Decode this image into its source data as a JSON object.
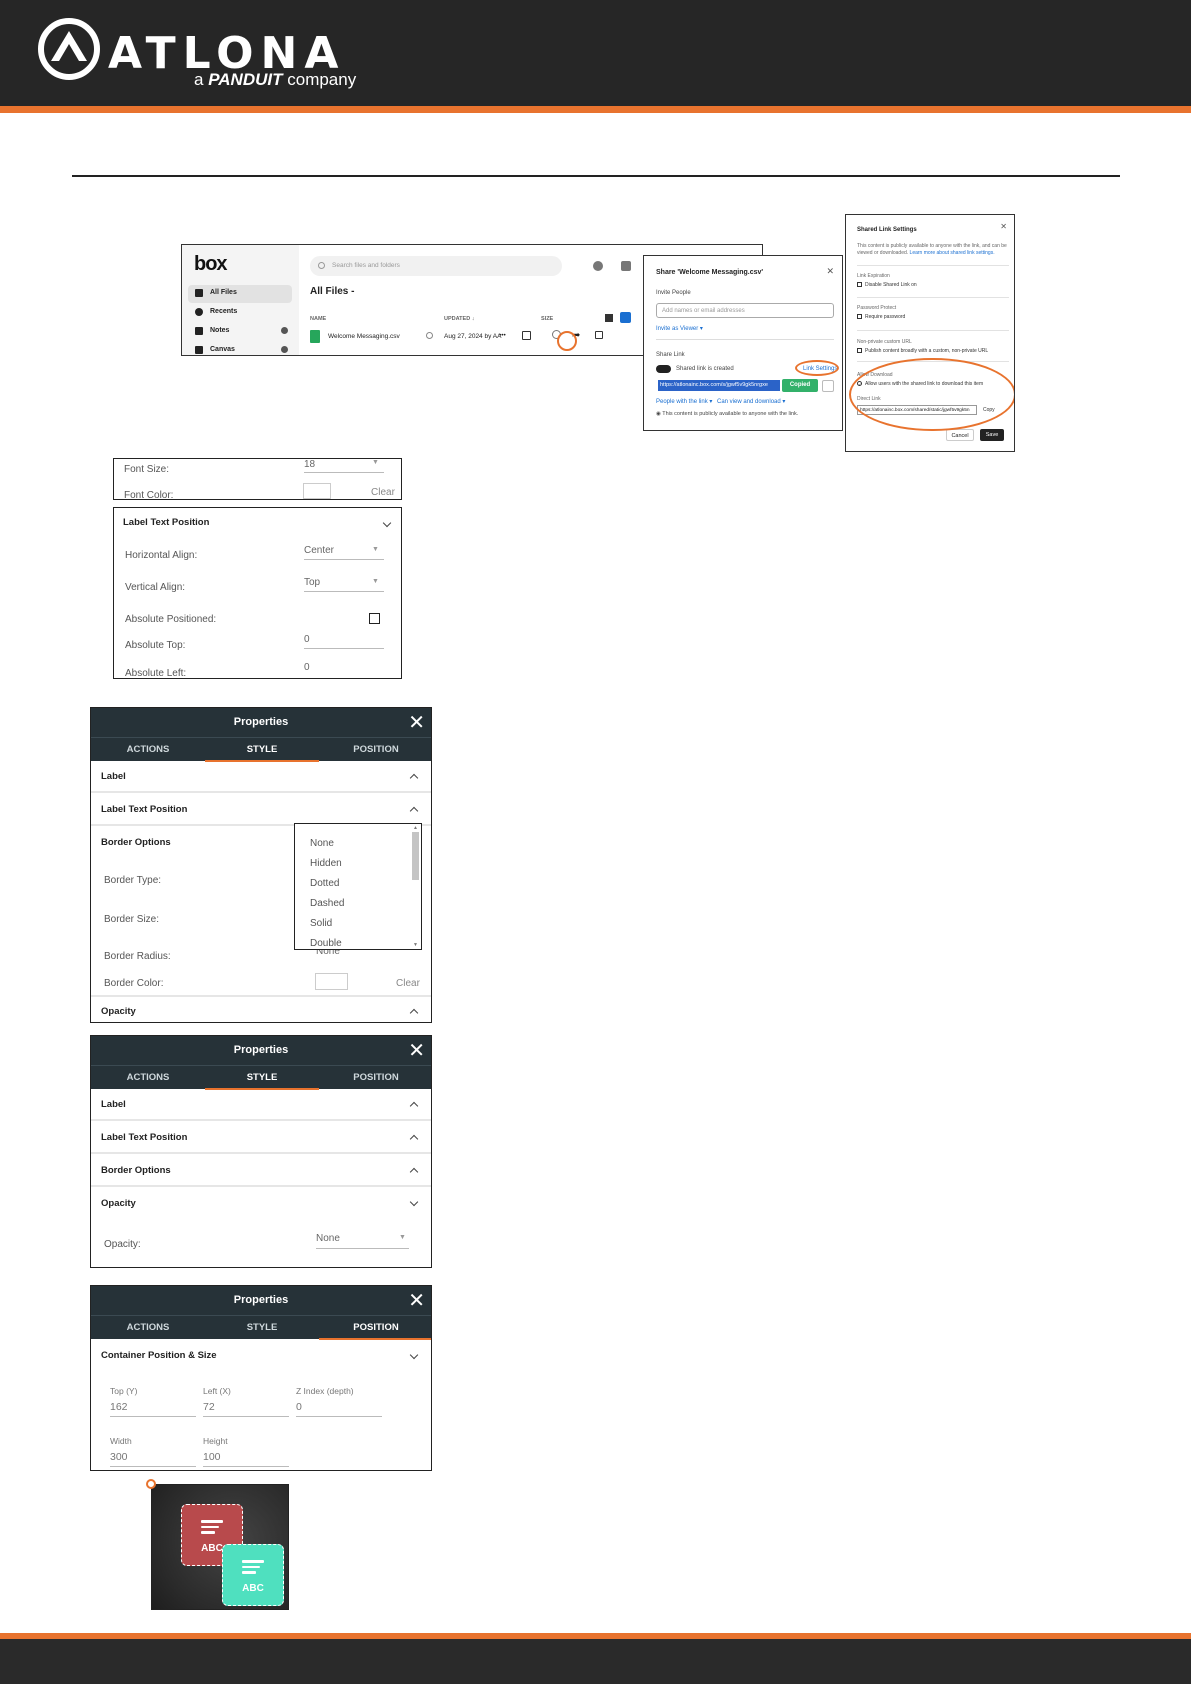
{
  "brand": {
    "name": "ATLONA",
    "tagline_prefix": "a",
    "tagline_brand": "PANDUIT",
    "tagline_suffix": "company",
    "accent_color": "#e8732e",
    "dark_color": "#262626"
  },
  "box_app": {
    "logo": "box",
    "nav": [
      {
        "label": "All Files",
        "icon": "folder-icon"
      },
      {
        "label": "Recents",
        "icon": "clock-icon"
      },
      {
        "label": "Notes",
        "icon": "notes-icon"
      },
      {
        "label": "Canvas",
        "icon": "canvas-icon"
      }
    ],
    "search_placeholder": "Search files and folders",
    "page_title": "All Files -",
    "columns": {
      "name": "NAME",
      "updated": "UPDATED ↓",
      "size": "SIZE"
    },
    "row": {
      "name": "Welcome Messaging.csv",
      "updated": "Aug 27, 2024 by AA",
      "more": "•••"
    }
  },
  "share_dialog": {
    "title": "Share 'Welcome Messaging.csv'",
    "invite_label": "Invite People",
    "invite_placeholder": "Add names or email addresses",
    "invite_role": "Invite as Viewer ▾",
    "share_link_label": "Share Link",
    "toggle_label": "Shared link is created",
    "link_settings": "Link Settings",
    "url": "https://atlonainc.box.com/s/jgwf5v9gk5nrgxe",
    "copied": "Copied",
    "people": "People with the link ▾",
    "permission": "Can view and download ▾",
    "notice": "This content is publicly available to anyone with the link."
  },
  "link_settings": {
    "title": "Shared Link Settings",
    "intro": "This content is publicly available to anyone with the link, and can be viewed or downloaded.",
    "intro_link": "Learn more about shared link settings.",
    "expiration_title": "Link Expiration",
    "expiration_option": "Disable Shared Link on",
    "password_title": "Password Protect",
    "password_option": "Require password",
    "vanity_title": "Non-private custom URL",
    "vanity_option": "Publish content broadly with a custom, non-private URL",
    "download_title": "Allow Download",
    "download_option": "Allow users with the shared link to download this item",
    "direct_title": "Direct Link",
    "direct_url": "https://atlonainc.box.com/shared/static/jgwf5v9gk5n",
    "copy": "Copy",
    "cancel": "Cancel",
    "save": "Save"
  },
  "font_panel": {
    "font_size_label": "Font Size:",
    "font_size_value": "18",
    "font_color_label": "Font Color:",
    "clear": "Clear"
  },
  "label_pos_panel": {
    "title": "Label Text Position",
    "horizontal_label": "Horizontal Align:",
    "horizontal_value": "Center",
    "vertical_label": "Vertical Align:",
    "vertical_value": "Top",
    "absolute_label": "Absolute Positioned:",
    "top_label": "Absolute Top:",
    "top_value": "0",
    "left_label": "Absolute Left:",
    "left_value": "0"
  },
  "props": {
    "title": "Properties",
    "tabs": [
      "ACTIONS",
      "STYLE",
      "POSITION"
    ]
  },
  "props1": {
    "sections": [
      "Label",
      "Label Text Position",
      "Border Options",
      "Opacity"
    ],
    "border_type": "Border Type:",
    "border_size": "Border Size:",
    "border_radius": "Border Radius:",
    "border_radius_value": "None",
    "border_color": "Border Color:",
    "clear": "Clear",
    "dropdown_options": [
      "None",
      "Hidden",
      "Dotted",
      "Dashed",
      "Solid",
      "Double"
    ]
  },
  "props2": {
    "sections": [
      "Label",
      "Label Text Position",
      "Border Options",
      "Opacity"
    ],
    "opacity_label": "Opacity:",
    "opacity_value": "None"
  },
  "props3": {
    "section": "Container Position & Size",
    "fields": [
      {
        "label": "Top (Y)",
        "value": "162"
      },
      {
        "label": "Left (X)",
        "value": "72"
      },
      {
        "label": "Z Index (depth)",
        "value": "0"
      },
      {
        "label": "Width",
        "value": "300"
      },
      {
        "label": "Height",
        "value": "100"
      }
    ]
  },
  "preview": {
    "tile1_text": "ABC",
    "tile2_text": "ABC",
    "tile1_color": "#b84a4c",
    "tile2_color": "#4fe0bf"
  }
}
